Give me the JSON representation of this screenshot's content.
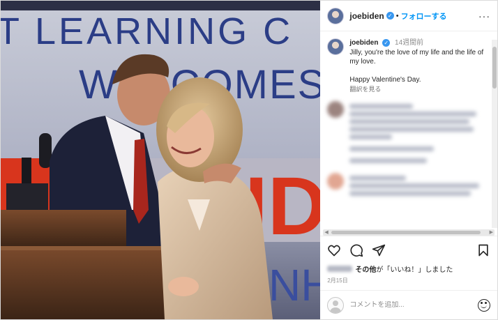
{
  "post": {
    "photo_banner_line1": "T LEARNING C",
    "photo_banner_line2": "WELCOMES",
    "photo_banner_red": "ID",
    "photo_banner_blue": "NH"
  },
  "header": {
    "username": "joebiden",
    "verified_mark": "✓",
    "dot": "•",
    "follow_label": "フォローする",
    "more_label": "···"
  },
  "caption": {
    "username": "joebiden",
    "verified_mark": "✓",
    "time": "14週間前",
    "text": "Jilly, you're the love of my life and the life of my love.\n\nHappy Valentine's Day.",
    "translate_label": "翻訳を見る"
  },
  "icons": {
    "like": "heart-icon",
    "comment": "comment-icon",
    "share": "share-icon",
    "save": "bookmark-icon"
  },
  "likes": {
    "suffix_bold": "その他",
    "suffix_text": "が「いいね！」しました"
  },
  "date": "2月15日",
  "comment_box": {
    "placeholder": "コメントを追加..."
  },
  "colors": {
    "accent": "#0095f6",
    "verified": "#3897f0",
    "text": "#262626",
    "muted": "#8e8e8e"
  }
}
